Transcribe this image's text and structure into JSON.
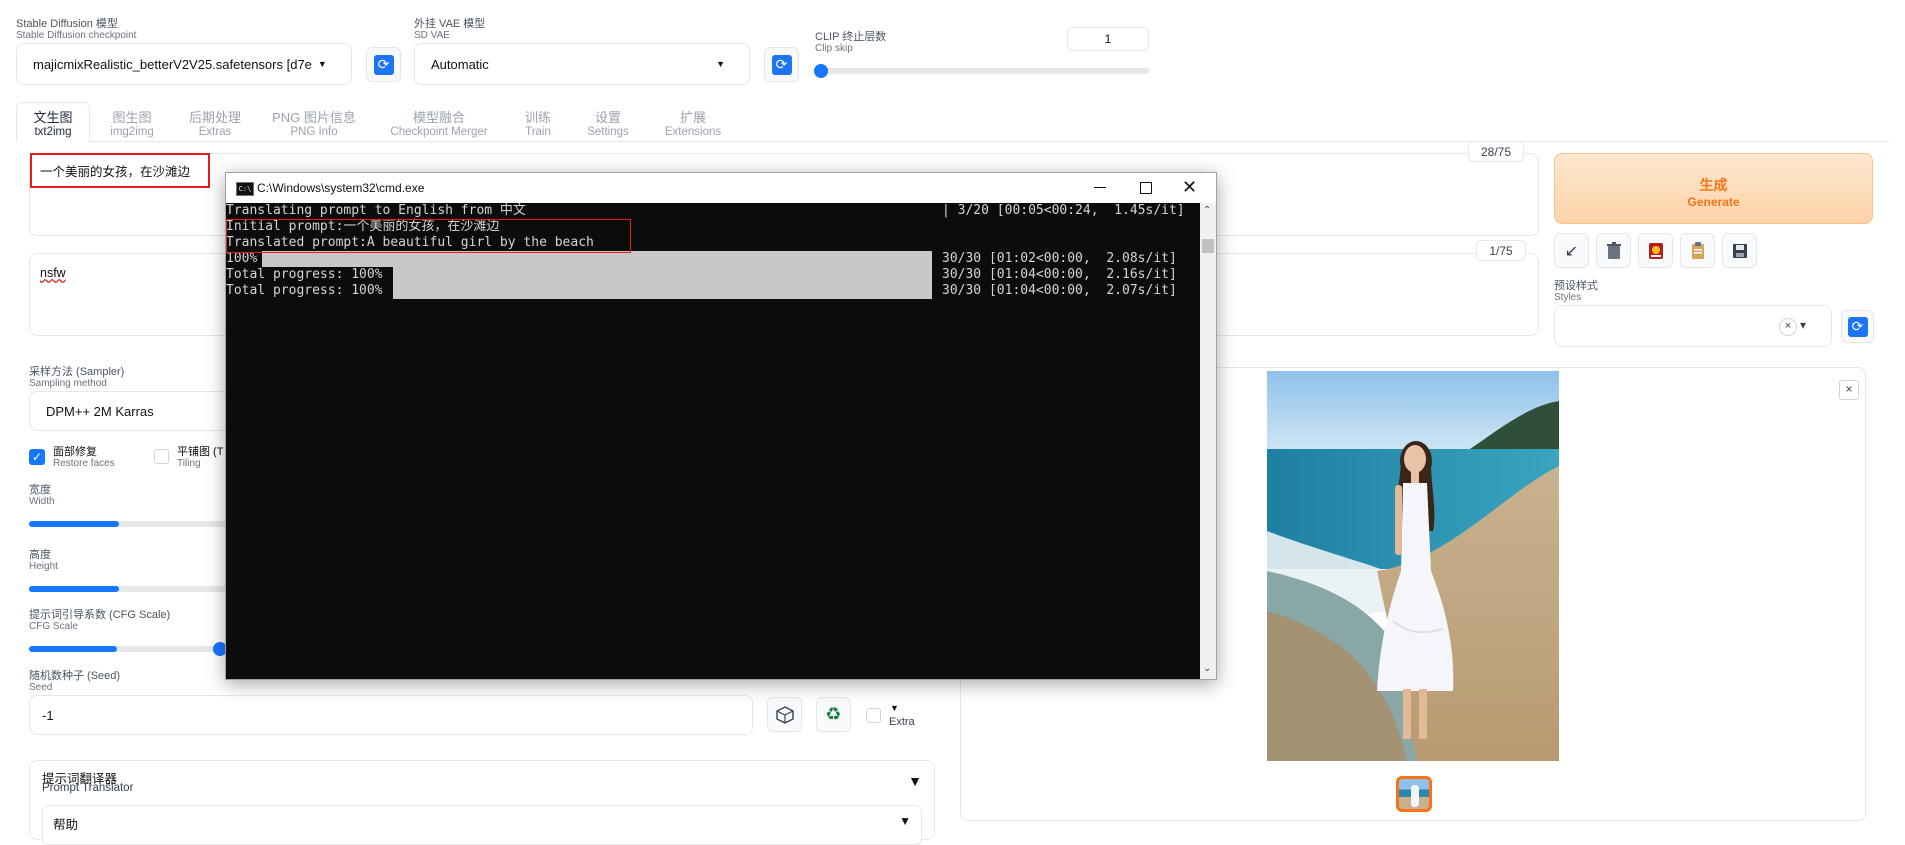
{
  "top": {
    "checkpoint_label_cn": "Stable Diffusion 模型",
    "checkpoint_label_en": "Stable Diffusion checkpoint",
    "checkpoint_value": "majicmixRealistic_betterV2V25.safetensors [d7e",
    "vae_label_cn": "外挂 VAE 模型",
    "vae_label_en": "SD VAE",
    "vae_value": "Automatic",
    "clip_label_cn": "CLIP 终止层数",
    "clip_label_en": "Clip skip",
    "clip_value": "1"
  },
  "tabs": [
    {
      "cn": "文生图",
      "en": "txt2img"
    },
    {
      "cn": "图生图",
      "en": "img2img"
    },
    {
      "cn": "后期处理",
      "en": "Extras"
    },
    {
      "cn": "PNG 图片信息",
      "en": "PNG Info"
    },
    {
      "cn": "模型融合",
      "en": "Checkpoint Merger"
    },
    {
      "cn": "训练",
      "en": "Train"
    },
    {
      "cn": "设置",
      "en": "Settings"
    },
    {
      "cn": "扩展",
      "en": "Extensions"
    }
  ],
  "prompt": {
    "positive": "一个美丽的女孩，在沙滩边",
    "positive_count": "28/75",
    "negative": "nsfw",
    "negative_count": "1/75"
  },
  "generate": {
    "cn": "生成",
    "en": "Generate"
  },
  "styles": {
    "label_cn": "预设样式",
    "label_en": "Styles",
    "clear": "×",
    "dropdown": "▾"
  },
  "params": {
    "sampler_label_cn": "采样方法 (Sampler)",
    "sampler_label_en": "Sampling method",
    "sampler_value": "DPM++ 2M Karras",
    "restore_cn": "面部修复",
    "restore_en": "Restore faces",
    "tiling_cn": "平铺图 (T",
    "tiling_en": "Tiling",
    "width_cn": "宽度",
    "width_en": "Width",
    "height_cn": "高度",
    "height_en": "Height",
    "cfg_cn": "提示词引导系数 (CFG Scale)",
    "cfg_en": "CFG Scale",
    "seed_cn": "随机数种子 (Seed)",
    "seed_en": "Seed",
    "seed_value": "-1",
    "extra_label": "Extra",
    "extra_arrow": "▼",
    "translator_cn": "提示词翻译器",
    "translator_en": "Prompt Translator",
    "translator_arrow": "▼",
    "help_label": "帮助",
    "help_arrow": "▼"
  },
  "sliders": {
    "clip_fraction": 0.0,
    "width_fraction": 0.45,
    "height_fraction": 0.45,
    "cfg_fraction": 0.44
  },
  "cmd": {
    "title": "C:\\Windows\\system32\\cmd.exe",
    "lines": [
      "Translating prompt to English from 中文",
      "Initial prompt:一个美丽的女孩，在沙滩边",
      "Translated prompt:A beautiful girl by the beach",
      "100%",
      "Total progress: 100%",
      "Total progress: 100%"
    ],
    "right": [
      "| 3/20 [00:05<00:24,  1.45s/it]",
      "",
      "",
      "30/30 [01:02<00:00,  2.08s/it]",
      "30/30 [01:04<00:00,  2.16s/it]",
      "30/30 [01:04<00:00,  2.07s/it]"
    ]
  },
  "output": {
    "close": "×"
  },
  "colors": {
    "accent": "#f97316",
    "blue": "#1677ff",
    "highlight_box": "#e11d1d",
    "cmd_bg": "#0c0c0c"
  }
}
